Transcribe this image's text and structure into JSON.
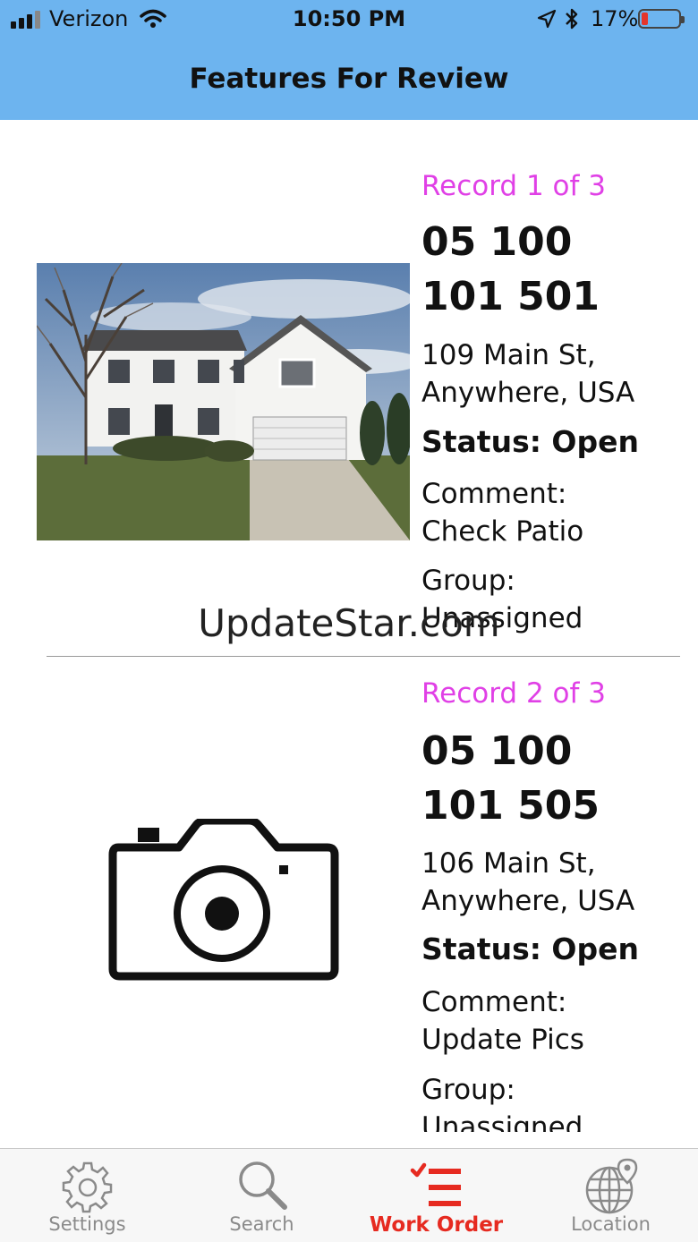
{
  "status_bar": {
    "carrier": "Verizon",
    "time": "10:50 PM",
    "battery": "17%",
    "battery_level": 0.17
  },
  "nav": {
    "title": "Features For Review"
  },
  "records": [
    {
      "counter": "Record 1 of 3",
      "id_line1": "05 100",
      "id_line2": "101 501",
      "address_line1": "109 Main St,",
      "address_line2": "Anywhere, USA",
      "status": "Status: Open",
      "comment_label": "Comment:",
      "comment_value": "Check Patio",
      "group_label": "Group:",
      "group_value": "Unassigned",
      "image": "house-photo"
    },
    {
      "counter": "Record 2 of 3",
      "id_line1": "05 100",
      "id_line2": "101 505",
      "address_line1": "106 Main St,",
      "address_line2": "Anywhere, USA",
      "status": "Status: Open",
      "comment_label": "Comment:",
      "comment_value": "Update Pics",
      "group_label": "Group:",
      "group_value": "Unassigned",
      "image": "camera-icon"
    }
  ],
  "watermark": "UpdateStar.com",
  "tabs": [
    {
      "label": "Settings",
      "icon": "gear-icon",
      "active": false
    },
    {
      "label": "Search",
      "icon": "search-icon",
      "active": false
    },
    {
      "label": "Work Order",
      "icon": "checklist-icon",
      "active": true
    },
    {
      "label": "Location",
      "icon": "globe-pin-icon",
      "active": false
    }
  ],
  "colors": {
    "nav_background": "#6db4ef",
    "record_counter": "#e040e6",
    "active_tab": "#e62a20",
    "inactive_tab": "#8a8a8a",
    "battery_low": "#e4352b"
  }
}
